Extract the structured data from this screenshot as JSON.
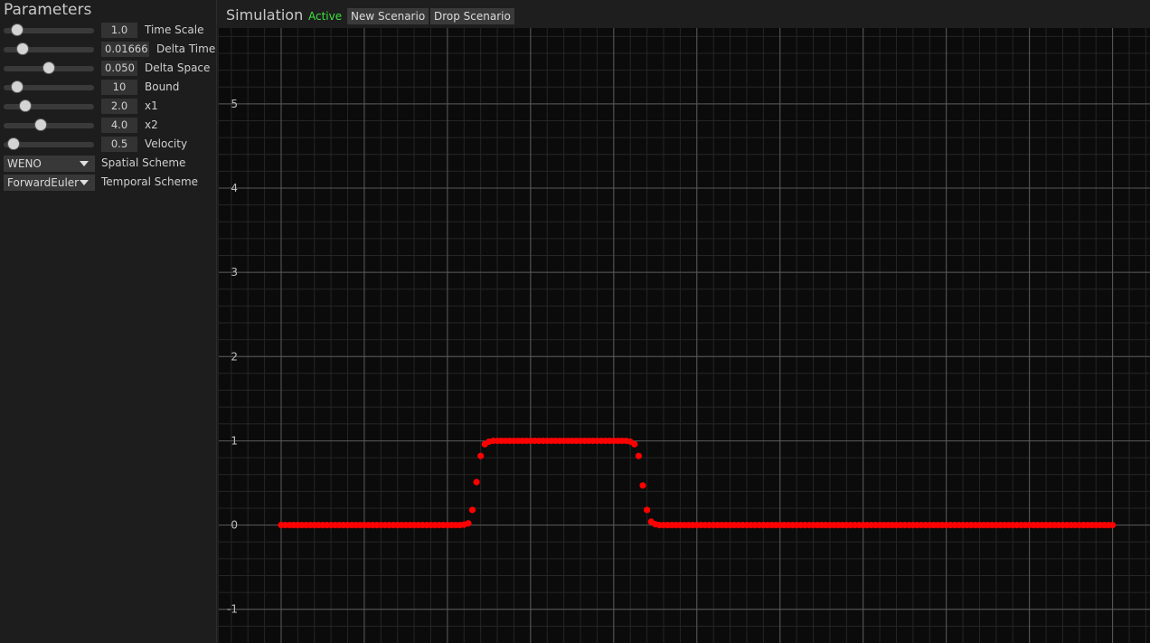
{
  "parameters": {
    "title": "Parameters",
    "sliders": [
      {
        "value": "1.0",
        "label": "Time Scale",
        "fraction": 0.15
      },
      {
        "value": "0.01666",
        "label": "Delta Time",
        "fraction": 0.21
      },
      {
        "value": "0.050",
        "label": "Delta Space",
        "fraction": 0.5
      },
      {
        "value": "10",
        "label": "Bound",
        "fraction": 0.15
      },
      {
        "value": "2.0",
        "label": "x1",
        "fraction": 0.24
      },
      {
        "value": "4.0",
        "label": "x2",
        "fraction": 0.41
      },
      {
        "value": "0.5",
        "label": "Velocity",
        "fraction": 0.11
      }
    ],
    "spatial_scheme": {
      "value": "WENO",
      "label": "Spatial Scheme"
    },
    "temporal_scheme": {
      "value": "ForwardEuler",
      "label": "Temporal Scheme"
    }
  },
  "simulation": {
    "title": "Simulation",
    "status": "Active",
    "new_scenario_label": "New Scenario",
    "drop_scenario_label": "Drop Scenario"
  },
  "colors": {
    "background": "#0b0b0b",
    "grid_major": "#5a5a5a",
    "grid_minor": "#262626",
    "points": "#ff0000",
    "status_active": "#3fe03f"
  },
  "chart_data": {
    "type": "scatter",
    "ylim": [
      -1.4,
      5.9
    ],
    "xlim": [
      -0.75,
      10.45
    ],
    "y_ticks": [
      "-1",
      "0",
      "1",
      "2",
      "3",
      "4",
      "5"
    ],
    "x_grid_lines": [
      0,
      1,
      2,
      3,
      4,
      5,
      6,
      7,
      8,
      9,
      10
    ],
    "grid": true,
    "series": [
      {
        "points": [
          [
            0.0,
            0.0
          ],
          [
            0.05,
            0.0
          ],
          [
            0.1,
            0.0
          ],
          [
            0.15,
            0.0
          ],
          [
            0.2,
            0.0
          ],
          [
            0.25,
            0.0
          ],
          [
            0.3,
            0.0
          ],
          [
            0.35,
            0.0
          ],
          [
            0.4,
            0.0
          ],
          [
            0.45,
            0.0
          ],
          [
            0.5,
            0.0
          ],
          [
            0.55,
            0.0
          ],
          [
            0.6,
            0.0
          ],
          [
            0.65,
            0.0
          ],
          [
            0.7,
            0.0
          ],
          [
            0.75,
            0.0
          ],
          [
            0.8,
            0.0
          ],
          [
            0.85,
            0.0
          ],
          [
            0.9,
            0.0
          ],
          [
            0.95,
            0.0
          ],
          [
            1.0,
            0.0
          ],
          [
            1.05,
            0.0
          ],
          [
            1.1,
            0.0
          ],
          [
            1.15,
            0.0
          ],
          [
            1.2,
            0.0
          ],
          [
            1.25,
            0.0
          ],
          [
            1.3,
            0.0
          ],
          [
            1.35,
            0.0
          ],
          [
            1.4,
            0.0
          ],
          [
            1.45,
            0.0
          ],
          [
            1.5,
            0.0
          ],
          [
            1.55,
            0.0
          ],
          [
            1.6,
            0.0
          ],
          [
            1.65,
            0.0
          ],
          [
            1.7,
            0.0
          ],
          [
            1.75,
            0.0
          ],
          [
            1.8,
            0.0
          ],
          [
            1.85,
            0.0
          ],
          [
            1.9,
            0.0
          ],
          [
            1.95,
            0.0
          ],
          [
            2.0,
            0.0
          ],
          [
            2.05,
            0.0
          ],
          [
            2.1,
            0.0
          ],
          [
            2.15,
            0.0
          ],
          [
            2.2,
            0.005
          ],
          [
            2.25,
            0.02
          ],
          [
            2.3,
            0.18
          ],
          [
            2.35,
            0.51
          ],
          [
            2.4,
            0.82
          ],
          [
            2.45,
            0.96
          ],
          [
            2.5,
            0.99
          ],
          [
            2.55,
            1.0
          ],
          [
            2.6,
            1.0
          ],
          [
            2.65,
            1.0
          ],
          [
            2.7,
            1.0
          ],
          [
            2.75,
            1.0
          ],
          [
            2.8,
            1.0
          ],
          [
            2.85,
            1.0
          ],
          [
            2.9,
            1.0
          ],
          [
            2.95,
            1.0
          ],
          [
            3.0,
            1.0
          ],
          [
            3.05,
            1.0
          ],
          [
            3.1,
            1.0
          ],
          [
            3.15,
            1.0
          ],
          [
            3.2,
            1.0
          ],
          [
            3.25,
            1.0
          ],
          [
            3.3,
            1.0
          ],
          [
            3.35,
            1.0
          ],
          [
            3.4,
            1.0
          ],
          [
            3.45,
            1.0
          ],
          [
            3.5,
            1.0
          ],
          [
            3.55,
            1.0
          ],
          [
            3.6,
            1.0
          ],
          [
            3.65,
            1.0
          ],
          [
            3.7,
            1.0
          ],
          [
            3.75,
            1.0
          ],
          [
            3.8,
            1.0
          ],
          [
            3.85,
            1.0
          ],
          [
            3.9,
            1.0
          ],
          [
            3.95,
            1.0
          ],
          [
            4.0,
            1.0
          ],
          [
            4.05,
            1.0
          ],
          [
            4.1,
            1.0
          ],
          [
            4.15,
            1.0
          ],
          [
            4.2,
            0.99
          ],
          [
            4.25,
            0.96
          ],
          [
            4.3,
            0.82
          ],
          [
            4.35,
            0.47
          ],
          [
            4.4,
            0.18
          ],
          [
            4.45,
            0.04
          ],
          [
            4.5,
            0.01
          ],
          [
            4.55,
            0.0
          ],
          [
            4.6,
            0.0
          ],
          [
            4.65,
            0.0
          ],
          [
            4.7,
            0.0
          ],
          [
            4.75,
            0.0
          ],
          [
            4.8,
            0.0
          ],
          [
            4.85,
            0.0
          ],
          [
            4.9,
            0.0
          ],
          [
            4.95,
            0.0
          ],
          [
            5.0,
            0.0
          ],
          [
            5.05,
            0.0
          ],
          [
            5.1,
            0.0
          ],
          [
            5.15,
            0.0
          ],
          [
            5.2,
            0.0
          ],
          [
            5.25,
            0.0
          ],
          [
            5.3,
            0.0
          ],
          [
            5.35,
            0.0
          ],
          [
            5.4,
            0.0
          ],
          [
            5.45,
            0.0
          ],
          [
            5.5,
            0.0
          ],
          [
            5.55,
            0.0
          ],
          [
            5.6,
            0.0
          ],
          [
            5.65,
            0.0
          ],
          [
            5.7,
            0.0
          ],
          [
            5.75,
            0.0
          ],
          [
            5.8,
            0.0
          ],
          [
            5.85,
            0.0
          ],
          [
            5.9,
            0.0
          ],
          [
            5.95,
            0.0
          ],
          [
            6.0,
            0.0
          ],
          [
            6.05,
            0.0
          ],
          [
            6.1,
            0.0
          ],
          [
            6.15,
            0.0
          ],
          [
            6.2,
            0.0
          ],
          [
            6.25,
            0.0
          ],
          [
            6.3,
            0.0
          ],
          [
            6.35,
            0.0
          ],
          [
            6.4,
            0.0
          ],
          [
            6.45,
            0.0
          ],
          [
            6.5,
            0.0
          ],
          [
            6.55,
            0.0
          ],
          [
            6.6,
            0.0
          ],
          [
            6.65,
            0.0
          ],
          [
            6.7,
            0.0
          ],
          [
            6.75,
            0.0
          ],
          [
            6.8,
            0.0
          ],
          [
            6.85,
            0.0
          ],
          [
            6.9,
            0.0
          ],
          [
            6.95,
            0.0
          ],
          [
            7.0,
            0.0
          ],
          [
            7.05,
            0.0
          ],
          [
            7.1,
            0.0
          ],
          [
            7.15,
            0.0
          ],
          [
            7.2,
            0.0
          ],
          [
            7.25,
            0.0
          ],
          [
            7.3,
            0.0
          ],
          [
            7.35,
            0.0
          ],
          [
            7.4,
            0.0
          ],
          [
            7.45,
            0.0
          ],
          [
            7.5,
            0.0
          ],
          [
            7.55,
            0.0
          ],
          [
            7.6,
            0.0
          ],
          [
            7.65,
            0.0
          ],
          [
            7.7,
            0.0
          ],
          [
            7.75,
            0.0
          ],
          [
            7.8,
            0.0
          ],
          [
            7.85,
            0.0
          ],
          [
            7.9,
            0.0
          ],
          [
            7.95,
            0.0
          ],
          [
            8.0,
            0.0
          ],
          [
            8.05,
            0.0
          ],
          [
            8.1,
            0.0
          ],
          [
            8.15,
            0.0
          ],
          [
            8.2,
            0.0
          ],
          [
            8.25,
            0.0
          ],
          [
            8.3,
            0.0
          ],
          [
            8.35,
            0.0
          ],
          [
            8.4,
            0.0
          ],
          [
            8.45,
            0.0
          ],
          [
            8.5,
            0.0
          ],
          [
            8.55,
            0.0
          ],
          [
            8.6,
            0.0
          ],
          [
            8.65,
            0.0
          ],
          [
            8.7,
            0.0
          ],
          [
            8.75,
            0.0
          ],
          [
            8.8,
            0.0
          ],
          [
            8.85,
            0.0
          ],
          [
            8.9,
            0.0
          ],
          [
            8.95,
            0.0
          ],
          [
            9.0,
            0.0
          ],
          [
            9.05,
            0.0
          ],
          [
            9.1,
            0.0
          ],
          [
            9.15,
            0.0
          ],
          [
            9.2,
            0.0
          ],
          [
            9.25,
            0.0
          ],
          [
            9.3,
            0.0
          ],
          [
            9.35,
            0.0
          ],
          [
            9.4,
            0.0
          ],
          [
            9.45,
            0.0
          ],
          [
            9.5,
            0.0
          ],
          [
            9.55,
            0.0
          ],
          [
            9.6,
            0.0
          ],
          [
            9.65,
            0.0
          ],
          [
            9.7,
            0.0
          ],
          [
            9.75,
            0.0
          ],
          [
            9.8,
            0.0
          ],
          [
            9.85,
            0.0
          ],
          [
            9.9,
            0.0
          ],
          [
            9.95,
            0.0
          ],
          [
            10.0,
            0.0
          ]
        ]
      }
    ]
  }
}
